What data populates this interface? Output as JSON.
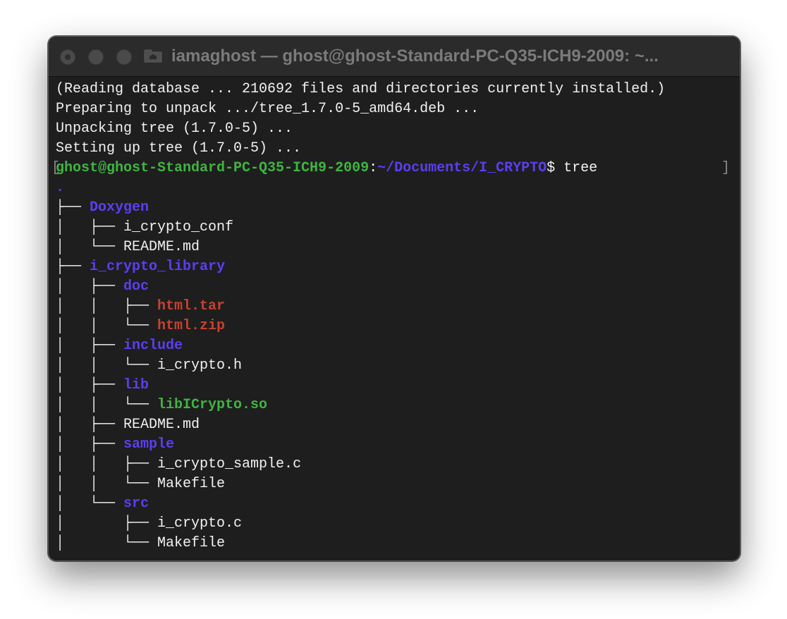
{
  "window": {
    "title": "iamaghost — ghost@ghost-Standard-PC-Q35-ICH9-2009: ~..."
  },
  "colors": {
    "prompt_user": "#3fb541",
    "prompt_path": "#5a3ff0",
    "directory": "#5a3ff0",
    "archive": "#c8412f",
    "shared_lib": "#3fb541",
    "text": "#f2f2f2",
    "background": "#1e1e1e"
  },
  "terminal": {
    "output_lines": [
      "(Reading database ... 210692 files and directories currently installed.)",
      "Preparing to unpack .../tree_1.7.0-5_amd64.deb ...",
      "Unpacking tree (1.7.0-5) ...",
      "Setting up tree (1.7.0-5) ..."
    ],
    "prompt": {
      "open_bracket": "[",
      "user_host": "ghost@ghost-Standard-PC-Q35-ICH9-2009",
      "separator": ":",
      "path": "~/Documents/I_CRYPTO",
      "symbol": "$ ",
      "command": "tree",
      "close_bracket": "]"
    },
    "tree": [
      {
        "prefix": "",
        "name": ".",
        "kind": "directory"
      },
      {
        "prefix": "├── ",
        "name": "Doxygen",
        "kind": "directory"
      },
      {
        "prefix": "│   ├── ",
        "name": "i_crypto_conf",
        "kind": "file"
      },
      {
        "prefix": "│   └── ",
        "name": "README.md",
        "kind": "file"
      },
      {
        "prefix": "├── ",
        "name": "i_crypto_library",
        "kind": "directory"
      },
      {
        "prefix": "│   ├── ",
        "name": "doc",
        "kind": "directory"
      },
      {
        "prefix": "│   │   ├── ",
        "name": "html.tar",
        "kind": "archive"
      },
      {
        "prefix": "│   │   └── ",
        "name": "html.zip",
        "kind": "archive"
      },
      {
        "prefix": "│   ├── ",
        "name": "include",
        "kind": "directory"
      },
      {
        "prefix": "│   │   └── ",
        "name": "i_crypto.h",
        "kind": "file"
      },
      {
        "prefix": "│   ├── ",
        "name": "lib",
        "kind": "directory"
      },
      {
        "prefix": "│   │   └── ",
        "name": "libICrypto.so",
        "kind": "shared_lib"
      },
      {
        "prefix": "│   ├── ",
        "name": "README.md",
        "kind": "file"
      },
      {
        "prefix": "│   ├── ",
        "name": "sample",
        "kind": "directory"
      },
      {
        "prefix": "│   │   ├── ",
        "name": "i_crypto_sample.c",
        "kind": "file"
      },
      {
        "prefix": "│   │   └── ",
        "name": "Makefile",
        "kind": "file"
      },
      {
        "prefix": "│   └── ",
        "name": "src",
        "kind": "directory"
      },
      {
        "prefix": "│       ├── ",
        "name": "i_crypto.c",
        "kind": "file"
      },
      {
        "prefix": "│       └── ",
        "name": "Makefile",
        "kind": "file"
      }
    ]
  }
}
